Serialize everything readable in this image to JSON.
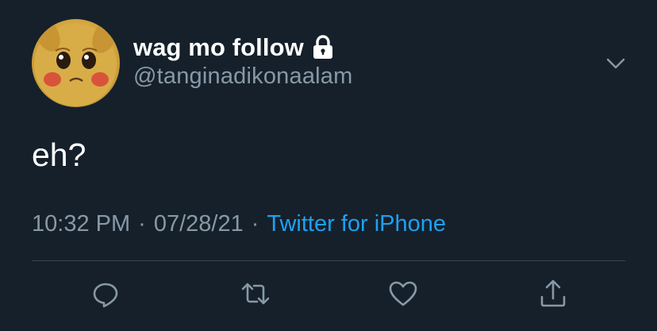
{
  "colors": {
    "background": "#15202b",
    "primary_text": "#ffffff",
    "secondary_text": "#8899a6",
    "link": "#1da1f2",
    "divider": "#38444d"
  },
  "author": {
    "display_name": "wag mo follow",
    "username": "@tanginadikonaalam",
    "locked_icon": "lock-icon",
    "avatar_icon": "avatar"
  },
  "tweet": {
    "text": "eh?",
    "time": "10:32 PM",
    "separator1": "·",
    "date": "07/28/21",
    "separator2": "·",
    "source": "Twitter for iPhone"
  },
  "actions": {
    "reply_icon": "reply-icon",
    "retweet_icon": "retweet-icon",
    "like_icon": "heart-icon",
    "share_icon": "share-icon"
  },
  "menu": {
    "caret_icon": "chevron-down-icon"
  }
}
